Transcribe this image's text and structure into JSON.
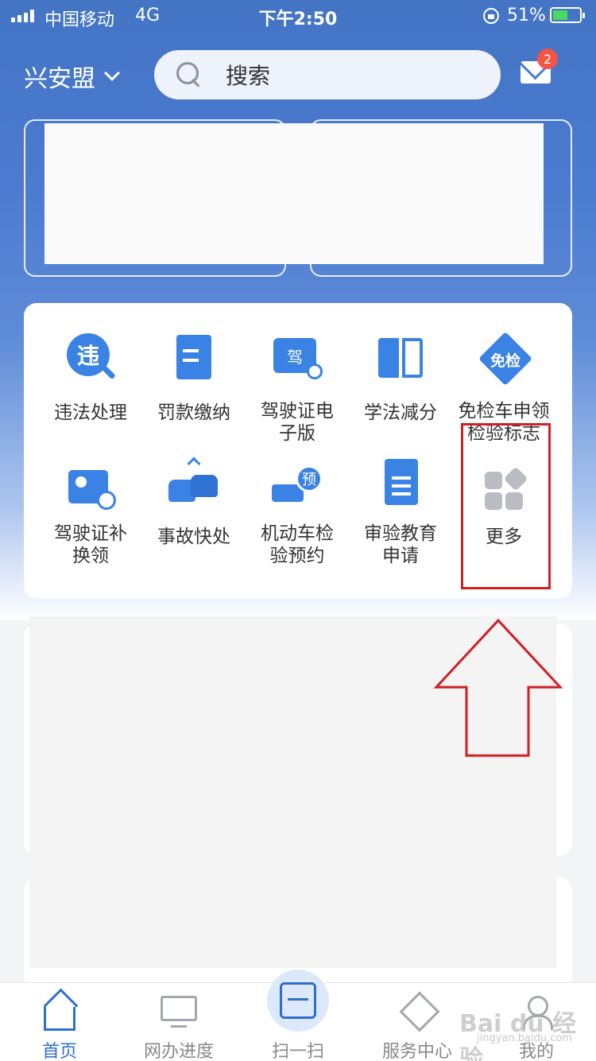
{
  "status_bar": {
    "carrier": "中国移动",
    "network": "4G",
    "time": "下午2:50",
    "battery": "51%"
  },
  "header": {
    "city": "兴安盟",
    "search_placeholder": "搜索",
    "badge_count": "2"
  },
  "services": [
    {
      "label": "违法处理",
      "icon": "violation-search-icon",
      "glyph": "违"
    },
    {
      "label": "罚款缴纳",
      "icon": "fine-receipt-icon"
    },
    {
      "label": "驾驶证电\n子版",
      "icon": "electronic-license-icon",
      "glyph": "驾"
    },
    {
      "label": "学法减分",
      "icon": "study-book-icon"
    },
    {
      "label": "免检车申领\n检验标志",
      "icon": "exemption-badge-icon",
      "glyph": "免检"
    },
    {
      "label": "驾驶证补\n换领",
      "icon": "license-replace-icon"
    },
    {
      "label": "事故快处",
      "icon": "accident-cars-icon"
    },
    {
      "label": "机动车检\n验预约",
      "icon": "inspection-booking-icon",
      "glyph": "预"
    },
    {
      "label": "审验教育\n申请",
      "icon": "document-icon"
    },
    {
      "label": "更多",
      "icon": "more-grid-icon"
    }
  ],
  "tabs": [
    {
      "label": "首页",
      "icon": "home-icon"
    },
    {
      "label": "网办进度",
      "icon": "monitor-icon"
    },
    {
      "label": "扫一扫",
      "icon": "scan-icon"
    },
    {
      "label": "服务中心",
      "icon": "service-center-icon"
    },
    {
      "label": "我的",
      "icon": "user-icon"
    }
  ],
  "watermark": {
    "main": "Bai du 经验",
    "sub": "jingyan.baidu.com"
  },
  "colors": {
    "brand_blue": "#4b7bd0",
    "accent": "#2f6fcf",
    "highlight_red": "#d01f26",
    "badge_red": "#f25545"
  }
}
